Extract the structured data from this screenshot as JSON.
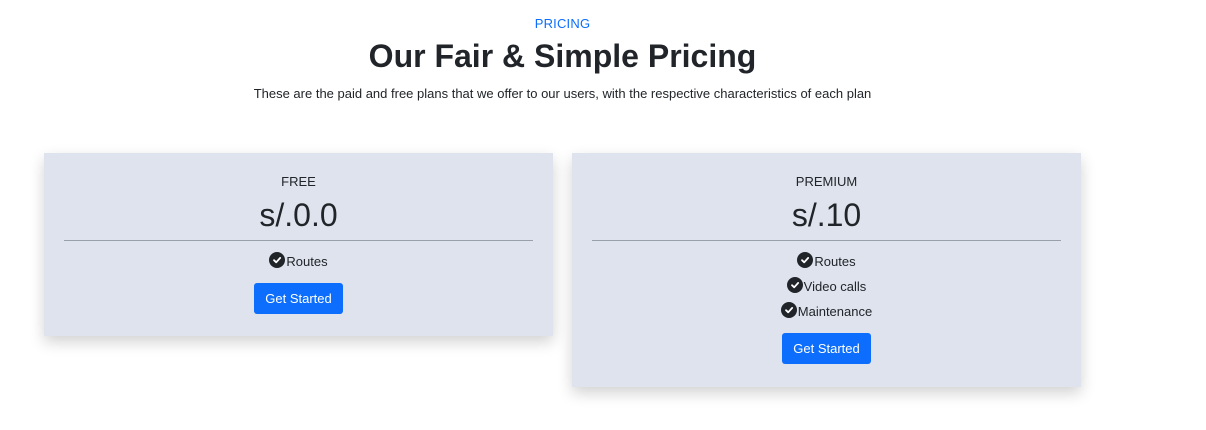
{
  "header": {
    "eyebrow": "PRICING",
    "title": "Our Fair & Simple Pricing",
    "subtitle": "These are the paid and free plans that we offer to our users, with the respective characteristics of each plan"
  },
  "plans": [
    {
      "name": "FREE",
      "price": "s/.0.0",
      "features": [
        "Routes"
      ],
      "button_label": "Get Started"
    },
    {
      "name": "PREMIUM",
      "price": "s/.10",
      "features": [
        "Routes",
        "Video calls",
        "Maintenance"
      ],
      "button_label": "Get Started"
    }
  ],
  "colors": {
    "accent": "#0d6efd",
    "card_background": "#dee3ed",
    "text": "#212529"
  },
  "icons": {
    "feature_check": "check-circle-icon"
  }
}
